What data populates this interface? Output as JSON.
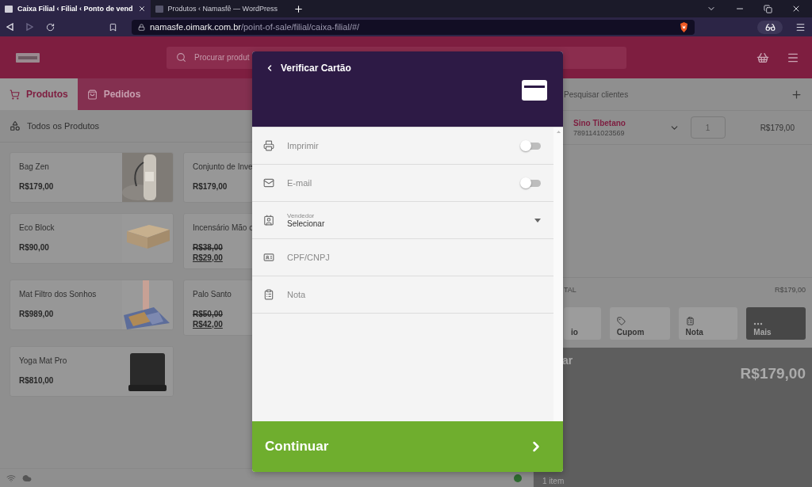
{
  "browser": {
    "tabs": [
      {
        "title": "Caixa Filial ‹ Filial ‹ Ponto de vend",
        "selected": true
      },
      {
        "title": "Produtos ‹ Namasfê — WordPress",
        "selected": false
      }
    ],
    "url": {
      "host": "namasfe.oimark.com.br",
      "path": "/point-of-sale/filial/caixa-filial/#/"
    }
  },
  "header": {
    "search": {
      "placeholder": "Procurar produt"
    }
  },
  "nav_tabs": [
    {
      "label": "Produtos",
      "selected": true
    },
    {
      "label": "Pedidos",
      "selected": false
    }
  ],
  "category": {
    "label": "Todos os Produtos"
  },
  "products": [
    {
      "name": "Bag Zen",
      "picture": true,
      "prices": [
        {
          "value": "R$179,00",
          "kind": "regular"
        }
      ]
    },
    {
      "name": "Conjunto de Inve",
      "picture": false,
      "prices": [
        {
          "value": "R$179,00",
          "kind": "regular"
        }
      ]
    },
    {
      "name": "Eco Block",
      "picture": true,
      "prices": [
        {
          "value": "R$90,00",
          "kind": "regular"
        }
      ]
    },
    {
      "name": "Incensário Mão c",
      "picture": false,
      "prices": [
        {
          "value": "R$38,00",
          "kind": "old"
        },
        {
          "value": "R$29,00",
          "kind": "sale"
        }
      ]
    },
    {
      "name": "Mat Filtro dos Sonhos",
      "picture": true,
      "prices": [
        {
          "value": "R$989,00",
          "kind": "regular"
        }
      ]
    },
    {
      "name": "Palo Santo",
      "picture": false,
      "prices": [
        {
          "value": "R$50,00",
          "kind": "old"
        },
        {
          "value": "R$42,00",
          "kind": "sale"
        }
      ]
    },
    {
      "name": "Yoga Mat Pro",
      "picture": true,
      "prices": [
        {
          "value": "R$810,00",
          "kind": "regular"
        }
      ]
    }
  ],
  "cart": {
    "search": {
      "placeholder": "Pesquisar clientes"
    },
    "items": [
      {
        "name": "Sino Tibetano",
        "code": "7891141023569",
        "quantity": "1",
        "price": "R$179,00"
      }
    ],
    "total": {
      "label": "TAL",
      "value": "R$179,00"
    },
    "actions": [
      {
        "label": "io",
        "emphasized": false
      },
      {
        "label": "Cupom",
        "emphasized": false
      },
      {
        "label": "Nota",
        "emphasized": false
      },
      {
        "label": "Mais",
        "emphasized": true
      }
    ],
    "checkout": {
      "label": "ar",
      "total": "R$179,00",
      "count": "1 item"
    }
  },
  "status_bar": {
    "online": true
  },
  "modal": {
    "title": "Verificar Cartão",
    "rows": [
      {
        "kind": "toggle",
        "label": "Imprimir",
        "on": false
      },
      {
        "kind": "toggle",
        "label": "E-mail",
        "on": false
      },
      {
        "kind": "select",
        "label": "Vendedor",
        "value": "Selecionar"
      },
      {
        "kind": "input",
        "placeholder": "CPF/CNPJ"
      },
      {
        "kind": "input",
        "placeholder": "Nota"
      }
    ],
    "continue_label": "Continuar"
  }
}
